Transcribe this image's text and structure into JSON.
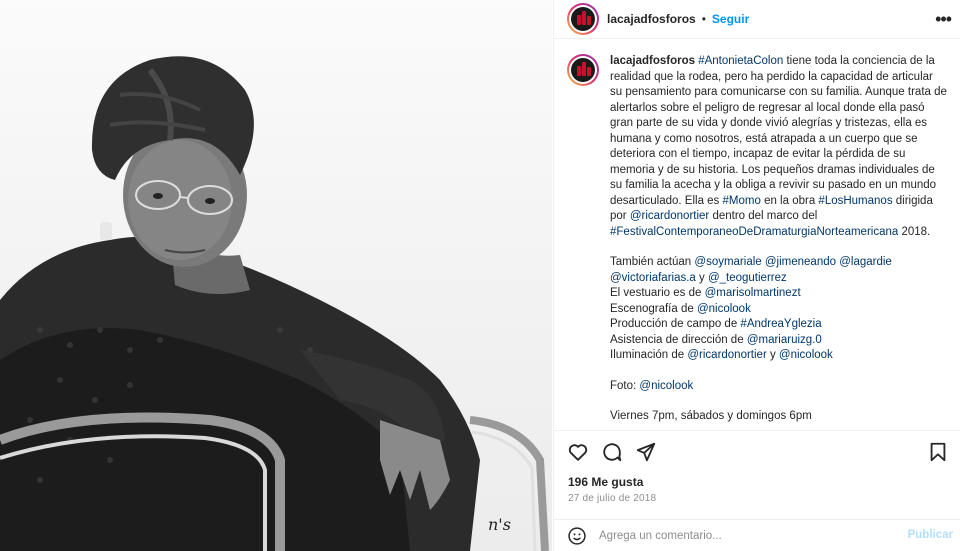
{
  "post": {
    "signature": "n's"
  },
  "header": {
    "username": "lacajadfosforos",
    "dot": "•",
    "follow_label": "Seguir",
    "more_icon": "more-horizontal-icon"
  },
  "caption": {
    "username": "lacajadfosforos",
    "p1_a": "#AntonietaColon",
    "p1_b": " tiene toda la conciencia de la realidad que la rodea, pero ha perdido la capacidad de articular su pensamiento para comunicarse con su familia. Aunque trata de alertarlos sobre el peligro de regresar al local donde ella pasó gran parte de su vida y donde vivió alegrías y tristezas, ella es humana y como nosotros, está atrapada a un cuerpo que se deteriora con el tiempo, incapaz de evitar la pérdida de su memoria y de su historia. Los pequeños dramas individuales de su familia la acecha y la obliga a revivir su pasado en un mundo desarticulado. Ella es ",
    "p1_c": "#Momo",
    "p1_d": " en la obra ",
    "p1_e": "#LosHumanos",
    "p1_f": " dirigida por ",
    "p1_g": "@ricardonortier",
    "p1_h": " dentro del marco del ",
    "p1_i": "#FestivalContemporaneoDeDramaturgiaNorteamericana",
    "p1_j": " 2018.",
    "cast_prefix": "También actúan ",
    "cast_1": "@soymariale",
    "cast_2": "@jimeneando",
    "cast_3": "@lagardie",
    "cast_4": "@victoriafarias.a",
    "cast_y": " y ",
    "cast_5": "@_teogutierrez",
    "vest_prefix": "El vestuario es de ",
    "vest_link": "@marisolmartinezt",
    "esc_prefix": "Escenografía de ",
    "esc_link": "@nicolook",
    "prod_prefix": "Producción de campo de ",
    "prod_link": "#AndreaYglezia",
    "asis_prefix": "Asistencia de dirección de ",
    "asis_link": "@mariaruizg.0",
    "ilum_prefix": "Iluminación de ",
    "ilum_link1": "@ricardonortier",
    "ilum_y": " y ",
    "ilum_link2": "@nicolook",
    "foto_prefix": "Foto: ",
    "foto_link": "@nicolook",
    "schedule": "Viernes 7pm, sábados y domingos 6pm"
  },
  "actions": {
    "icons": [
      "heart-icon",
      "comment-icon",
      "share-icon",
      "bookmark-icon"
    ],
    "likes": "196 Me gusta",
    "date": "27 de julio de 2018"
  },
  "comment": {
    "placeholder": "Agrega un comentario...",
    "emoji_icon": "emoji-icon",
    "publish_label": "Publicar"
  },
  "colors": {
    "link": "#00376b",
    "follow": "#0095f6",
    "publish_disabled": "#b2dffc"
  }
}
